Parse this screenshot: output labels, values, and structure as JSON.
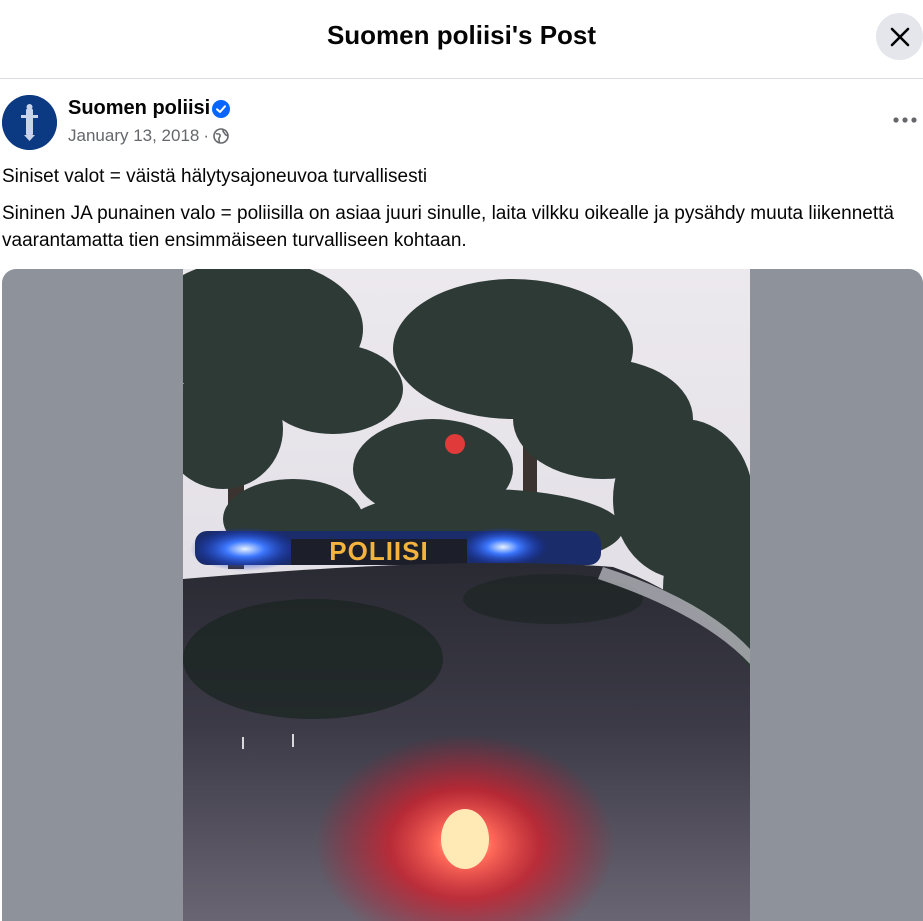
{
  "dialog": {
    "title": "Suomen poliisi's Post",
    "close_icon": "close-icon"
  },
  "post": {
    "author": "Suomen poliisi",
    "verified_icon": "verified-badge-icon",
    "date": "January 13, 2018",
    "separator": "·",
    "audience_icon": "globe-icon",
    "more_icon": "more-options-icon",
    "paragraphs": [
      "Siniset valot = väistä hälytysajoneuvoa turvallisesti",
      "Sininen JA punainen valo = poliisilla on asiaa juuri sinulle, laita vilkku oikealle ja pysähdy muuta liikennettä vaarantamatta tien ensimmäiseen turvalliseen kohtaan."
    ],
    "photo": {
      "light_bar_text": "POLIISI",
      "colors": {
        "blue_light": "#2f6bff",
        "red_light": "#ff2a2a",
        "sign_text": "#f3b33d"
      }
    }
  },
  "colors": {
    "accent": "#0866ff",
    "secondary_text": "#65676b",
    "media_background": "#8e939b"
  }
}
